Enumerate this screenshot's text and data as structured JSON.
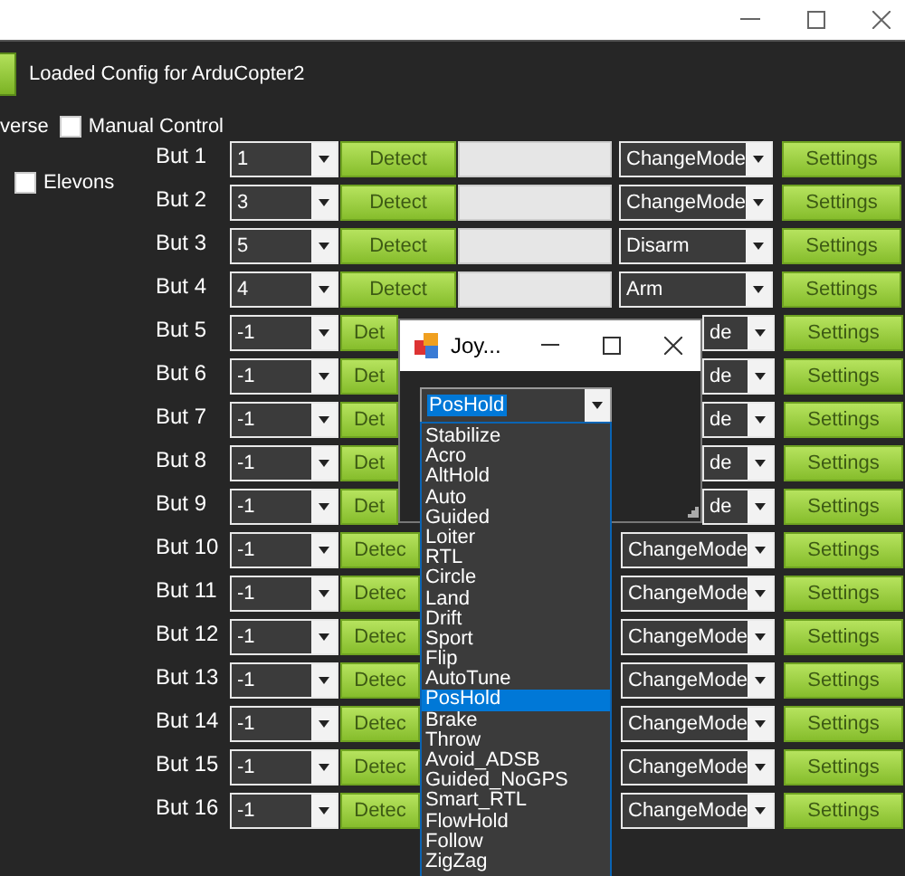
{
  "status": "Loaded Config for ArduCopter2",
  "cut_label": "verse",
  "manual_control": {
    "label": "Manual Control",
    "checked": false
  },
  "elevons": {
    "label": "Elevons",
    "checked": false
  },
  "buttons": [
    {
      "label": "But 1",
      "kind": "full",
      "channel": "1",
      "detect": "Detect",
      "action": "ChangeMode",
      "settings": "Settings"
    },
    {
      "label": "But 2",
      "kind": "full",
      "channel": "3",
      "detect": "Detect",
      "action": "ChangeMode",
      "settings": "Settings"
    },
    {
      "label": "But 3",
      "kind": "full",
      "channel": "5",
      "detect": "Detect",
      "action": "Disarm",
      "settings": "Settings"
    },
    {
      "label": "But 4",
      "kind": "full",
      "channel": "4",
      "detect": "Detect",
      "action": "Arm",
      "settings": "Settings"
    },
    {
      "label": "But 5",
      "kind": "under_dialog",
      "channel": "-1",
      "detect": "Det",
      "action": "de",
      "settings": "Settings"
    },
    {
      "label": "But 6",
      "kind": "under_dialog",
      "channel": "-1",
      "detect": "Det",
      "action": "de",
      "settings": "Settings"
    },
    {
      "label": "But 7",
      "kind": "under_dialog",
      "channel": "-1",
      "detect": "Det",
      "action": "de",
      "settings": "Settings"
    },
    {
      "label": "But 8",
      "kind": "under_dialog",
      "channel": "-1",
      "detect": "Det",
      "action": "de",
      "settings": "Settings"
    },
    {
      "label": "But 9",
      "kind": "under_dialog",
      "channel": "-1",
      "detect": "Det",
      "action": "de",
      "settings": "Settings"
    },
    {
      "label": "But 10",
      "kind": "under_list",
      "channel": "-1",
      "detect": "Detec",
      "action": "ChangeMode",
      "settings": "Settings"
    },
    {
      "label": "But 11",
      "kind": "under_list",
      "channel": "-1",
      "detect": "Detec",
      "action": "ChangeMode",
      "settings": "Settings"
    },
    {
      "label": "But 12",
      "kind": "under_list",
      "channel": "-1",
      "detect": "Detec",
      "action": "ChangeMode",
      "settings": "Settings"
    },
    {
      "label": "But 13",
      "kind": "under_list",
      "channel": "-1",
      "detect": "Detec",
      "action": "ChangeMode",
      "settings": "Settings"
    },
    {
      "label": "But 14",
      "kind": "under_list",
      "channel": "-1",
      "detect": "Detec",
      "action": "ChangeMode",
      "settings": "Settings"
    },
    {
      "label": "But 15",
      "kind": "under_list",
      "channel": "-1",
      "detect": "Detec",
      "action": "ChangeMode",
      "settings": "Settings"
    },
    {
      "label": "But 16",
      "kind": "under_list",
      "channel": "-1",
      "detect": "Detec",
      "action": "ChangeMode",
      "settings": "Settings"
    }
  ],
  "dialog": {
    "title": "Joy...",
    "mode": "PosHold",
    "options": [
      {
        "label": "Stabilize",
        "selected": false
      },
      {
        "label": "Acro",
        "selected": false
      },
      {
        "label": "AltHold",
        "selected": false
      },
      {
        "label": "Auto",
        "selected": false
      },
      {
        "label": "Guided",
        "selected": false
      },
      {
        "label": "Loiter",
        "selected": false
      },
      {
        "label": "RTL",
        "selected": false
      },
      {
        "label": "Circle",
        "selected": false
      },
      {
        "label": "Land",
        "selected": false
      },
      {
        "label": "Drift",
        "selected": false
      },
      {
        "label": "Sport",
        "selected": false
      },
      {
        "label": "Flip",
        "selected": false
      },
      {
        "label": "AutoTune",
        "selected": false
      },
      {
        "label": "PosHold",
        "selected": true
      },
      {
        "label": "Brake",
        "selected": false
      },
      {
        "label": "Throw",
        "selected": false
      },
      {
        "label": "Avoid_ADSB",
        "selected": false
      },
      {
        "label": "Guided_NoGPS",
        "selected": false
      },
      {
        "label": "Smart_RTL",
        "selected": false
      },
      {
        "label": "FlowHold",
        "selected": false
      },
      {
        "label": "Follow",
        "selected": false
      },
      {
        "label": "ZigZag",
        "selected": false
      }
    ]
  }
}
